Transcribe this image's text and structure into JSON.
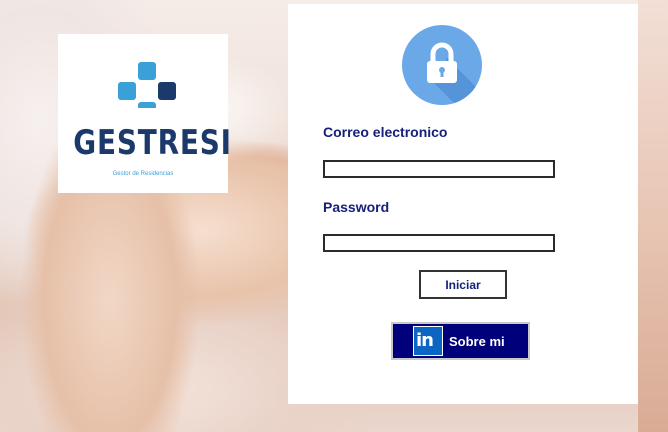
{
  "logo": {
    "wordmark": "GESTRESI",
    "tagline": "Gestor de Residencias",
    "colors": {
      "light_blue": "#3aa1d8",
      "dark_blue": "#1b3a6b"
    }
  },
  "login": {
    "icon": "lock-icon",
    "email_label": "Correo electronico",
    "email_value": "",
    "password_label": "Password",
    "password_value": "",
    "submit_label": "Iniciar",
    "about_label": "Sobre mi",
    "about_icon": "linkedin-icon",
    "linkedin_glyph": "in"
  },
  "colors": {
    "label_text": "#16207a",
    "about_bg": "#00007a",
    "lock_circle": "#6aa8e8"
  }
}
